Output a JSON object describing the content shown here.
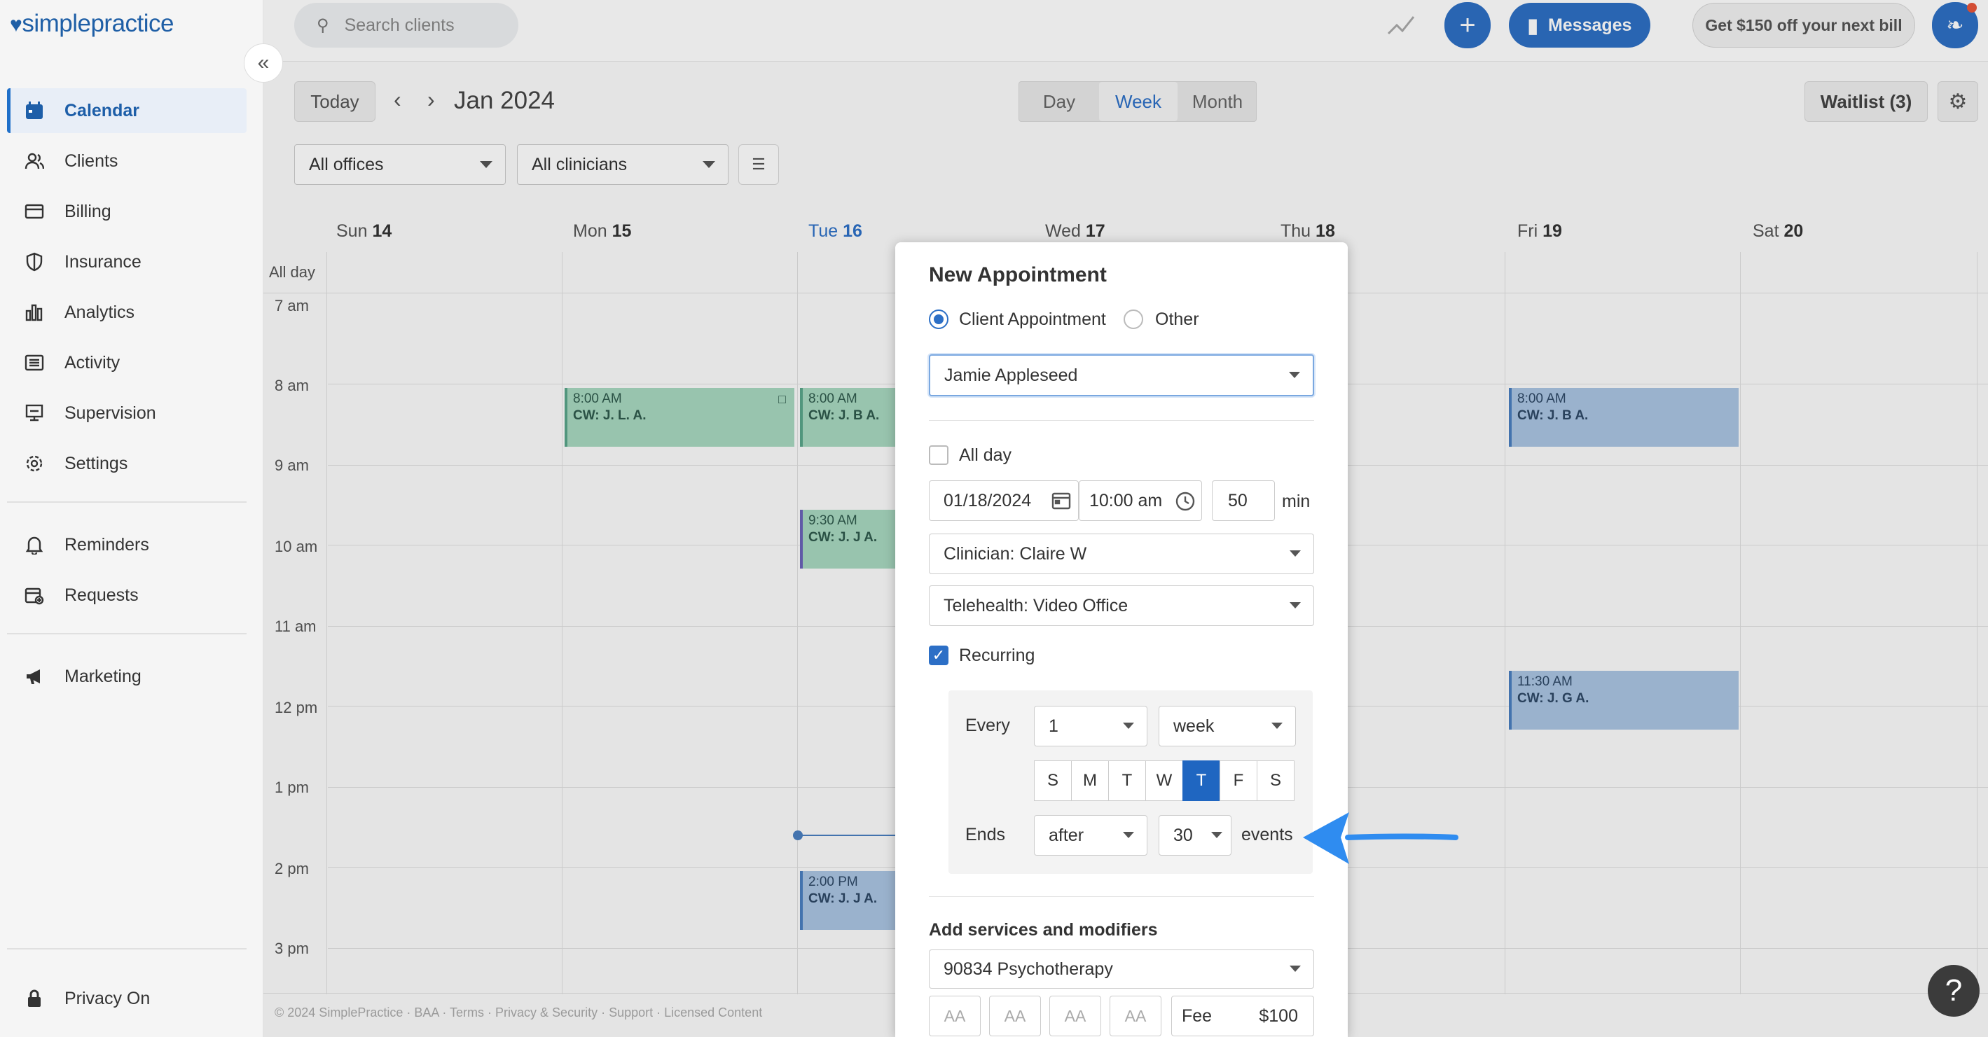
{
  "app": {
    "logo_text": "simplepractice"
  },
  "sidebar": {
    "items": [
      {
        "label": "Calendar",
        "icon": "calendar-icon"
      },
      {
        "label": "Clients",
        "icon": "clients-icon"
      },
      {
        "label": "Billing",
        "icon": "card-icon"
      },
      {
        "label": "Insurance",
        "icon": "shield-icon"
      },
      {
        "label": "Analytics",
        "icon": "bar-chart-icon"
      },
      {
        "label": "Activity",
        "icon": "list-icon"
      },
      {
        "label": "Supervision",
        "icon": "supervision-icon"
      },
      {
        "label": "Settings",
        "icon": "gear-icon"
      },
      {
        "label": "Reminders",
        "icon": "bell-icon"
      },
      {
        "label": "Requests",
        "icon": "calendar-plus-icon"
      },
      {
        "label": "Marketing",
        "icon": "megaphone-icon"
      }
    ],
    "privacy_label": "Privacy On"
  },
  "topbar": {
    "search_placeholder": "Search clients",
    "messages_label": "Messages",
    "promo_label": "Get $150 off your next bill"
  },
  "toolbar": {
    "today_label": "Today",
    "period_label": "Jan 2024",
    "views": [
      "Day",
      "Week",
      "Month"
    ],
    "active_view": "Week",
    "waitlist_label": "Waitlist (3)",
    "offices_filter": "All offices",
    "clinicians_filter": "All clinicians"
  },
  "calendar": {
    "days": [
      {
        "dow": "Sun",
        "num": "14"
      },
      {
        "dow": "Mon",
        "num": "15"
      },
      {
        "dow": "Tue",
        "num": "16"
      },
      {
        "dow": "Wed",
        "num": "17"
      },
      {
        "dow": "Thu",
        "num": "18"
      },
      {
        "dow": "Fri",
        "num": "19"
      },
      {
        "dow": "Sat",
        "num": "20"
      }
    ],
    "all_day_label": "All day",
    "hours": [
      "7 am",
      "8 am",
      "9 am",
      "10 am",
      "11 am",
      "12 pm",
      "1 pm",
      "2 pm",
      "3 pm"
    ],
    "events": [
      {
        "time": "8:00 AM",
        "title": "CW: J. L. A.",
        "color": "green"
      },
      {
        "time": "8:00 AM",
        "title": "CW: J. B A.",
        "color": "green"
      },
      {
        "time": "9:30 AM",
        "title": "CW: J. J A.",
        "color": "green"
      },
      {
        "time": "2:00 PM",
        "title": "CW: J. J A.",
        "color": "blue"
      },
      {
        "time": "8:00 AM",
        "title": "CW: J. B A.",
        "color": "blue"
      },
      {
        "time": "11:30 AM",
        "title": "CW: J. G A.",
        "color": "blue"
      }
    ],
    "footer": "© 2024 SimplePractice · BAA · Terms · Privacy & Security · Support · Licensed Content"
  },
  "modal": {
    "title": "New Appointment",
    "type_options": [
      "Client Appointment",
      "Other"
    ],
    "client": "Jamie Appleseed",
    "all_day_label": "All day",
    "date": "01/18/2024",
    "time": "10:00 am",
    "duration": "50",
    "duration_unit": "min",
    "clinician": "Clinician: Claire W",
    "location": "Telehealth: Video Office",
    "recurring_label": "Recurring",
    "every_label": "Every",
    "every_value": "1",
    "every_unit": "week",
    "weekdays": [
      "S",
      "M",
      "T",
      "W",
      "T",
      "F",
      "S"
    ],
    "selected_weekday_index": 4,
    "ends_label": "Ends",
    "ends_mode": "after",
    "ends_count": "30",
    "ends_suffix": "events",
    "services_heading": "Add services and modifiers",
    "service": "90834 Psychotherapy",
    "modifiers": [
      "AA",
      "AA",
      "AA",
      "AA"
    ],
    "fee_label": "Fee",
    "fee_value": "$100"
  },
  "colors": {
    "accent": "#2c6fc6",
    "event_green": "#a8d8c0",
    "event_blue": "#aac4e2",
    "arrow": "#2f8cf0"
  }
}
